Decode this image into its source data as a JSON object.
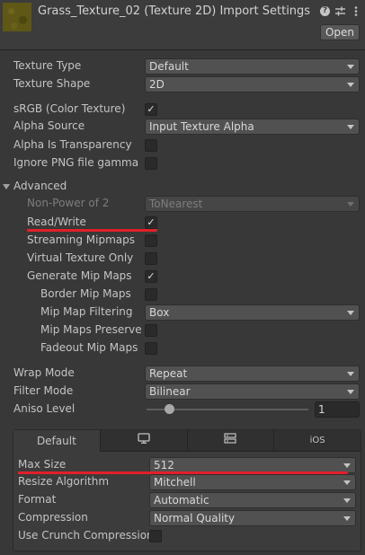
{
  "header": {
    "title": "Grass_Texture_02 (Texture 2D) Import Settings",
    "open_label": "Open",
    "icons": [
      "help-icon",
      "settings-sliders-icon",
      "more-vert-icon"
    ]
  },
  "fields": {
    "texture_type": {
      "label": "Texture Type",
      "value": "Default"
    },
    "texture_shape": {
      "label": "Texture Shape",
      "value": "2D"
    },
    "srgb": {
      "label": "sRGB (Color Texture)",
      "checked": true
    },
    "alpha_source": {
      "label": "Alpha Source",
      "value": "Input Texture Alpha"
    },
    "alpha_is_transparency": {
      "label": "Alpha Is Transparency",
      "checked": false
    },
    "ignore_png_gamma": {
      "label": "Ignore PNG file gamma",
      "checked": false
    },
    "advanced": {
      "label": "Advanced"
    },
    "non_power_of_2": {
      "label": "Non-Power of 2",
      "value": "ToNearest"
    },
    "read_write": {
      "label": "Read/Write",
      "checked": true
    },
    "streaming_mipmaps": {
      "label": "Streaming Mipmaps",
      "checked": false
    },
    "virtual_texture_only": {
      "label": "Virtual Texture Only",
      "checked": false
    },
    "generate_mip_maps": {
      "label": "Generate Mip Maps",
      "checked": true
    },
    "border_mip_maps": {
      "label": "Border Mip Maps",
      "checked": false
    },
    "mip_map_filtering": {
      "label": "Mip Map Filtering",
      "value": "Box"
    },
    "mip_maps_preserve": {
      "label": "Mip Maps Preserve C",
      "checked": false
    },
    "fadeout_mip_maps": {
      "label": "Fadeout Mip Maps",
      "checked": false
    },
    "wrap_mode": {
      "label": "Wrap Mode",
      "value": "Repeat"
    },
    "filter_mode": {
      "label": "Filter Mode",
      "value": "Bilinear"
    },
    "aniso_level": {
      "label": "Aniso Level",
      "value": "1",
      "slider_fraction": 0.0625
    }
  },
  "platform": {
    "tabs": [
      {
        "label": "Default",
        "icon": ""
      },
      {
        "label": "",
        "icon": "monitor-icon"
      },
      {
        "label": "",
        "icon": "server-icon"
      },
      {
        "label": "iOS",
        "icon": ""
      }
    ],
    "max_size": {
      "label": "Max Size",
      "value": "512"
    },
    "resize_algorithm": {
      "label": "Resize Algorithm",
      "value": "Mitchell"
    },
    "format": {
      "label": "Format",
      "value": "Automatic"
    },
    "compression": {
      "label": "Compression",
      "value": "Normal Quality"
    },
    "use_crunch": {
      "label": "Use Crunch Compression",
      "checked": false
    }
  },
  "colors": {
    "background": "#383838",
    "highlight_line": "#e0202a"
  }
}
